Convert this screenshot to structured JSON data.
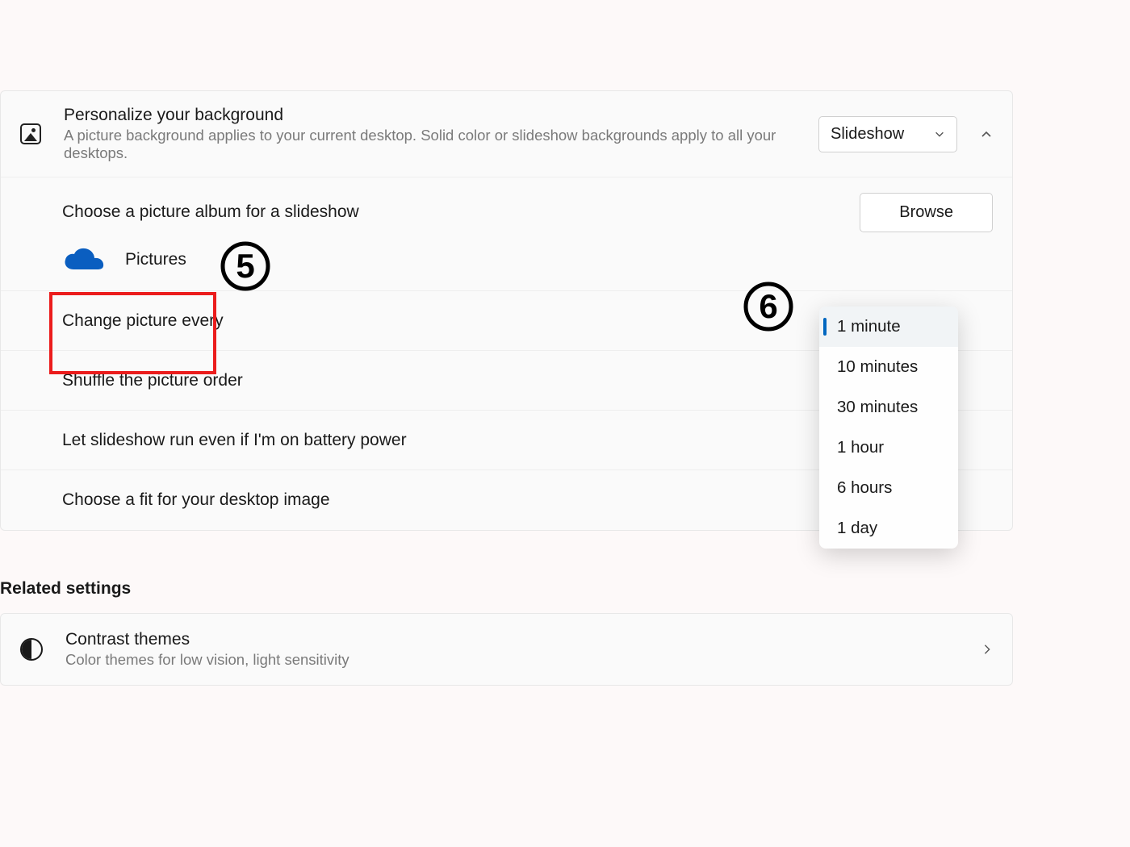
{
  "header": {
    "title": "Personalize your background",
    "subtitle": "A picture background applies to your current desktop. Solid color or slideshow backgrounds apply to all your desktops.",
    "dropdown_value": "Slideshow"
  },
  "rows": {
    "choose_album_label": "Choose a picture album for a slideshow",
    "browse_label": "Browse",
    "album_name": "Pictures",
    "change_every_label": "Change picture every",
    "shuffle_label": "Shuffle the picture order",
    "battery_label": "Let slideshow run even if I'm on battery power",
    "fit_label": "Choose a fit for your desktop image"
  },
  "dropdown_menu": {
    "options": [
      "1 minute",
      "10 minutes",
      "30 minutes",
      "1 hour",
      "6 hours",
      "1 day"
    ],
    "selected": "1 minute"
  },
  "related": {
    "heading": "Related settings",
    "contrast_title": "Contrast themes",
    "contrast_sub": "Color themes for low vision, light sensitivity"
  },
  "annotations": {
    "5": "5",
    "6": "6"
  }
}
